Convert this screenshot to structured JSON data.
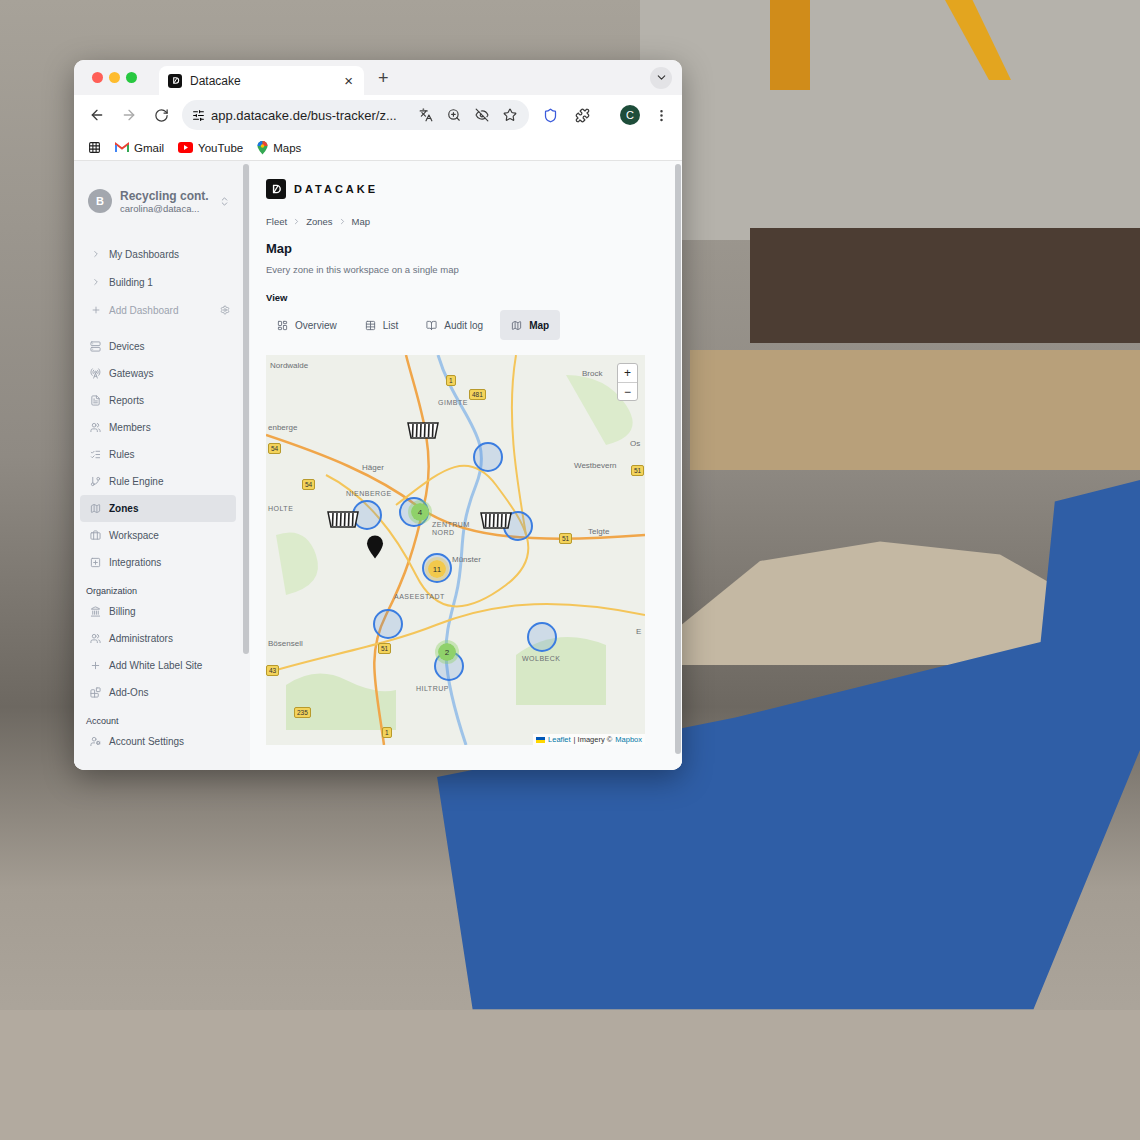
{
  "browser": {
    "tab": {
      "title": "Datacake",
      "close": "×"
    },
    "new_tab": "+",
    "url": "app.datacake.de/bus-tracker/z...",
    "profile": "C",
    "bookmarks": [
      "Gmail",
      "YouTube",
      "Maps"
    ]
  },
  "sidebar": {
    "workspace": {
      "avatar": "B",
      "name": "Recycling cont.",
      "email": "carolina@dataca..."
    },
    "dashboards": [
      {
        "label": "My Dashboards",
        "kind": "folder"
      },
      {
        "label": "Building 1",
        "kind": "folder"
      },
      {
        "label": "Add Dashboard",
        "kind": "add"
      }
    ],
    "items": [
      {
        "label": "Devices",
        "selected": false
      },
      {
        "label": "Gateways",
        "selected": false
      },
      {
        "label": "Reports",
        "selected": false
      },
      {
        "label": "Members",
        "selected": false
      },
      {
        "label": "Rules",
        "selected": false
      },
      {
        "label": "Rule Engine",
        "selected": false
      },
      {
        "label": "Zones",
        "selected": true
      },
      {
        "label": "Workspace",
        "selected": false
      },
      {
        "label": "Integrations",
        "selected": false
      }
    ],
    "sections": [
      {
        "title": "Organization",
        "items": [
          {
            "label": "Billing",
            "selected": false
          },
          {
            "label": "Administrators",
            "selected": false
          },
          {
            "label": "Add White Label Site",
            "selected": false
          },
          {
            "label": "Add-Ons",
            "selected": false
          }
        ]
      },
      {
        "title": "Account",
        "items": [
          {
            "label": "Account Settings",
            "selected": false
          }
        ]
      }
    ]
  },
  "logo": "DATACAKE",
  "breadcrumb": [
    "Fleet",
    "Zones",
    "Map"
  ],
  "page": {
    "title": "Map",
    "subtitle": "Every zone in this workspace on a single map"
  },
  "view": {
    "label": "View",
    "tabs": [
      {
        "label": "Overview",
        "selected": false
      },
      {
        "label": "List",
        "selected": false
      },
      {
        "label": "Audit log",
        "selected": false
      },
      {
        "label": "Map",
        "selected": true
      }
    ]
  },
  "map": {
    "zoom": [
      "+",
      "−"
    ],
    "attribution": {
      "leaflet": "Leaflet",
      "rest": "| Imagery ©",
      "mapbox": "Mapbox"
    },
    "labels": [
      "Nordwalde",
      "Brock",
      "GIMBTE",
      "enberge",
      "Häger",
      "Westbevern",
      "Os",
      "HOLTE",
      "NIENBERGE",
      "ZENTRUM NORD",
      "Telgte",
      "Münster",
      "AASEESTADT",
      "Bösensell",
      "WOLBECK",
      "HILTRUP",
      "E"
    ],
    "roads": [
      "1",
      "481",
      "54",
      "54",
      "51",
      "51",
      "51",
      "43",
      "235",
      "1"
    ],
    "markers": [
      {
        "kind": "zone"
      },
      {
        "kind": "zone"
      },
      {
        "kind": "zone"
      },
      {
        "kind": "zone"
      },
      {
        "kind": "zone"
      },
      {
        "kind": "zone"
      },
      {
        "kind": "zone"
      },
      {
        "kind": "zone"
      },
      {
        "kind": "cluster",
        "count": "4",
        "color": "#8fd16a"
      },
      {
        "kind": "cluster",
        "count": "11",
        "color": "#f2c94c"
      },
      {
        "kind": "cluster",
        "count": "2",
        "color": "#8fd16a"
      },
      {
        "kind": "container"
      },
      {
        "kind": "container"
      },
      {
        "kind": "container"
      },
      {
        "kind": "pin"
      }
    ]
  }
}
